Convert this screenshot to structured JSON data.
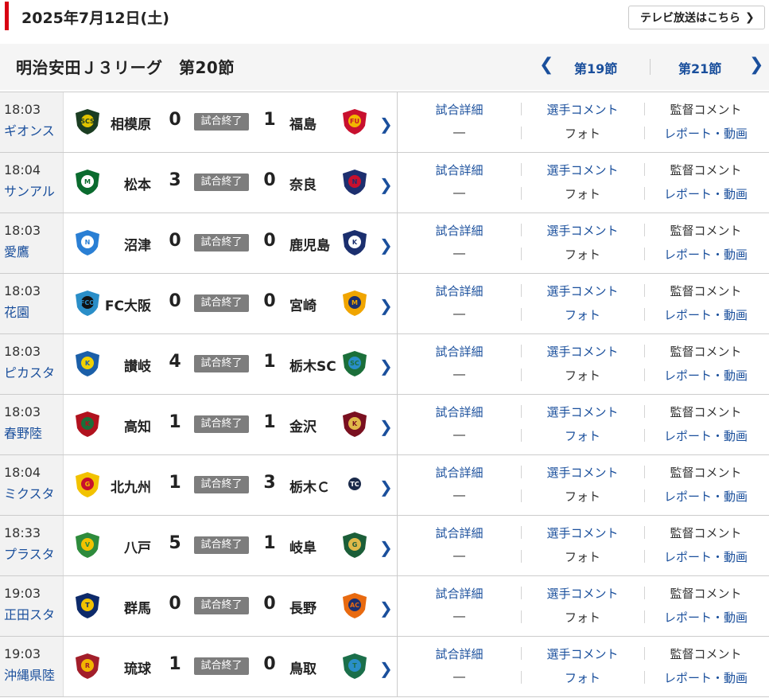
{
  "header": {
    "date": "2025年7月12日(土)",
    "tv_button_label": "テレビ放送はこちら",
    "tv_button_chevron": "❯"
  },
  "section": {
    "title": "明治安田Ｊ３リーグ　第20節",
    "prev_label": "第19節",
    "next_label": "第21節",
    "prev_arrow": "❮",
    "next_arrow": "❯"
  },
  "colors": {
    "accent_red": "#d80012",
    "link_blue": "#1a4f9c",
    "badge_gray": "#7d7d7d"
  },
  "matches": [
    {
      "time": "18:03",
      "venue": "ギオンス",
      "home": "相模原",
      "home_score": "0",
      "status": "試合終了",
      "away_score": "1",
      "away": "福島",
      "home_crest": {
        "icon": "sagamihara-crest-icon",
        "c1": "#1b3d22",
        "c2": "#e0c300",
        "t": "SCS"
      },
      "away_crest": {
        "icon": "fukushima-crest-icon",
        "c1": "#c8102e",
        "c2": "#f2b600",
        "t": "FU"
      }
    },
    {
      "time": "18:04",
      "venue": "サンアル",
      "home": "松本",
      "home_score": "3",
      "status": "試合終了",
      "away_score": "0",
      "away": "奈良",
      "home_crest": {
        "icon": "matsumoto-crest-icon",
        "c1": "#0a6b2e",
        "c2": "#ffffff",
        "t": "M"
      },
      "away_crest": {
        "icon": "nara-crest-icon",
        "c1": "#1d2f6f",
        "c2": "#c8102e",
        "t": "N"
      }
    },
    {
      "time": "18:03",
      "venue": "愛鷹",
      "home": "沼津",
      "home_score": "0",
      "status": "試合終了",
      "away_score": "0",
      "away": "鹿児島",
      "home_crest": {
        "icon": "numazu-crest-icon",
        "c1": "#2a7fd4",
        "c2": "#ffffff",
        "t": "N"
      },
      "away_crest": {
        "icon": "kagoshima-crest-icon",
        "c1": "#1b2f6e",
        "c2": "#ffffff",
        "t": "K"
      }
    },
    {
      "time": "18:03",
      "venue": "花園",
      "home": "FC大阪",
      "home_score": "0",
      "status": "試合終了",
      "away_score": "0",
      "away": "宮崎",
      "home_crest": {
        "icon": "fc-osaka-crest-icon",
        "c1": "#2a8ec8",
        "c2": "#111111",
        "t": "FCO"
      },
      "away_crest": {
        "icon": "miyazaki-crest-icon",
        "c1": "#f0a500",
        "c2": "#1b2f6e",
        "t": "M"
      }
    },
    {
      "time": "18:03",
      "venue": "ピカスタ",
      "home": "讃岐",
      "home_score": "4",
      "status": "試合終了",
      "away_score": "1",
      "away": "栃木SC",
      "home_crest": {
        "icon": "sanuki-crest-icon",
        "c1": "#1b5fa8",
        "c2": "#f2d200",
        "t": "K"
      },
      "away_crest": {
        "icon": "tochigi-sc-crest-icon",
        "c1": "#1b6f3a",
        "c2": "#2a8ec8",
        "t": "SC"
      }
    },
    {
      "time": "18:03",
      "venue": "春野陸",
      "home": "高知",
      "home_score": "1",
      "status": "試合終了",
      "away_score": "1",
      "away": "金沢",
      "home_crest": {
        "icon": "kochi-crest-icon",
        "c1": "#b1121e",
        "c2": "#1b6f3a",
        "t": "K"
      },
      "away_crest": {
        "icon": "kanazawa-crest-icon",
        "c1": "#7a1020",
        "c2": "#e0b84a",
        "t": "K"
      }
    },
    {
      "time": "18:04",
      "venue": "ミクスタ",
      "home": "北九州",
      "home_score": "1",
      "status": "試合終了",
      "away_score": "3",
      "away": "栃木Ｃ",
      "home_crest": {
        "icon": "kitakyushu-crest-icon",
        "c1": "#f2c200",
        "c2": "#c8102e",
        "t": "G"
      },
      "away_crest": {
        "icon": "tochigi-city-crest-icon",
        "c1": "#ffffff",
        "c2": "#1a2a4a",
        "t": "TC"
      }
    },
    {
      "time": "18:33",
      "venue": "プラスタ",
      "home": "八戸",
      "home_score": "5",
      "status": "試合終了",
      "away_score": "1",
      "away": "岐阜",
      "home_crest": {
        "icon": "hachinohe-crest-icon",
        "c1": "#2e8b3c",
        "c2": "#f2c200",
        "t": "V"
      },
      "away_crest": {
        "icon": "gifu-crest-icon",
        "c1": "#1b5e38",
        "c2": "#e0b84a",
        "t": "G"
      }
    },
    {
      "time": "19:03",
      "venue": "正田スタ",
      "home": "群馬",
      "home_score": "0",
      "status": "試合終了",
      "away_score": "0",
      "away": "長野",
      "home_crest": {
        "icon": "gunma-crest-icon",
        "c1": "#0d2a6a",
        "c2": "#f2c200",
        "t": "T"
      },
      "away_crest": {
        "icon": "nagano-crest-icon",
        "c1": "#e86a10",
        "c2": "#1b2f6e",
        "t": "AC"
      }
    },
    {
      "time": "19:03",
      "venue": "沖縄県陸",
      "home": "琉球",
      "home_score": "1",
      "status": "試合終了",
      "away_score": "0",
      "away": "鳥取",
      "home_crest": {
        "icon": "ryukyu-crest-icon",
        "c1": "#a21e2a",
        "c2": "#f2b600",
        "t": "R"
      },
      "away_crest": {
        "icon": "tottori-crest-icon",
        "c1": "#1b6f4a",
        "c2": "#2a8ec8",
        "t": "T"
      }
    }
  ],
  "links": {
    "detail": "試合詳細",
    "player_comment": "選手コメント",
    "manager_comment": "監督コメント",
    "none": "―",
    "photo": "フォト",
    "report": "レポート・動画"
  },
  "row_link_states": [
    {
      "manager_comment_link": false,
      "photo_link": false
    },
    {
      "manager_comment_link": false,
      "photo_link": false
    },
    {
      "manager_comment_link": false,
      "photo_link": false
    },
    {
      "manager_comment_link": false,
      "photo_link": true
    },
    {
      "manager_comment_link": false,
      "photo_link": false
    },
    {
      "manager_comment_link": false,
      "photo_link": true
    },
    {
      "manager_comment_link": false,
      "photo_link": false
    },
    {
      "manager_comment_link": false,
      "photo_link": false
    },
    {
      "manager_comment_link": false,
      "photo_link": false
    },
    {
      "manager_comment_link": false,
      "photo_link": true
    }
  ]
}
